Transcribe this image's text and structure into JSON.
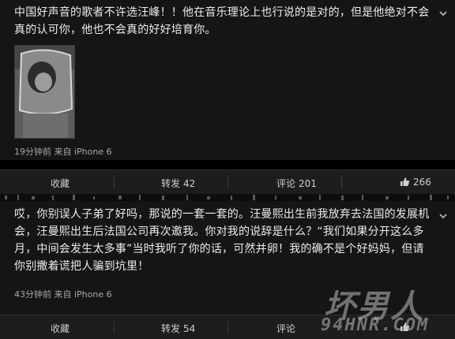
{
  "posts": [
    {
      "text": "中国好声音的歌者不许选汪峰！！他在音乐理论上也行说的是对的，但是他绝对不会真的认可你，他也不会真的好好培育你。",
      "meta": "19分钟前 来自 iPhone 6",
      "actions": {
        "favorite_label": "收藏",
        "repost_label": "转发",
        "repost_count": "42",
        "comment_label": "评论",
        "comment_count": "201",
        "like_count": "266"
      }
    },
    {
      "text": "哎，你别误人子弟了好吗，那说的一套一套的。汪曼熙出生前我放弃去法国的发展机会，汪曼熙出生后法国公司再次邀我。你对我的说辞是什么？“我们如果分开这么多月，中间会发生太多事”当时我听了你的话，可然并卵！我的确不是个好妈妈，但请你别撒着谎把人骗到坑里！",
      "meta": "43分钟前 来自 iPhone 6",
      "actions": {
        "favorite_label": "收藏",
        "repost_label": "转发",
        "repost_count": "54",
        "comment_label": "评论",
        "comment_count": "",
        "like_count": ""
      }
    }
  ],
  "watermark": {
    "main": "坏男人",
    "sub": "94HNR.COM"
  },
  "icons": {
    "more": "chevron-down-icon",
    "like": "thumbs-up-icon",
    "image": "image-thumbnail"
  },
  "colors": {
    "background": "#151515",
    "text": "#ececec",
    "meta": "#a8a8a8",
    "actions_bar": "#1d1d1d"
  }
}
